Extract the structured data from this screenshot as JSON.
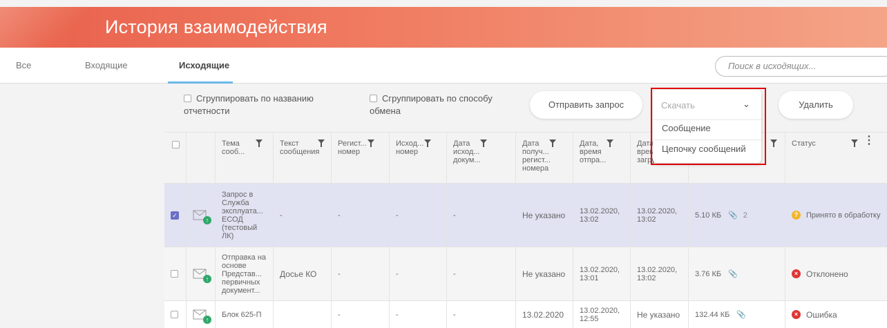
{
  "page_title": "История взаимодействия",
  "tabs": [
    "Все",
    "Входящие",
    "Исходящие"
  ],
  "search": {
    "placeholder": "Поиск в исходящих..."
  },
  "options": {
    "group_by_report": "Сгруппировать по названию отчетности",
    "group_by_exchange": "Сгруппировать по способу обмена"
  },
  "actions": {
    "send_request": "Отправить запрос",
    "download": "Скачать",
    "delete": "Удалить"
  },
  "download_menu": [
    "Сообщение",
    "Цепочку сообщений"
  ],
  "columns": [
    "Тема сооб...",
    "Текст сообщения",
    "Регист... номер",
    "Исход... номер",
    "Дата исход... докум...",
    "Дата получ... регист... номера",
    "Дата, время отпра...",
    "Дата, время загруз...",
    "",
    "Статус"
  ],
  "rows": [
    {
      "selected": true,
      "subject": "Запрос в Служба эксплуата... ЕСОД (тестовый ЛК)",
      "text": "-",
      "reg_no": "-",
      "out_no": "-",
      "out_date": "-",
      "reg_date": "Не указано",
      "sent": "13.02.2020, 13:02",
      "uploaded": "13.02.2020, 13:02",
      "size": "5.10 КБ",
      "attachments": "2",
      "status": "Принято в обработку",
      "status_color": "#f2b52b"
    },
    {
      "selected": false,
      "subject": "Отправка на основе Представ... первичных документ...",
      "text": "Досье КО",
      "reg_no": "-",
      "out_no": "-",
      "out_date": "-",
      "reg_date": "Не указано",
      "sent": "13.02.2020, 13:01",
      "uploaded": "13.02.2020, 13:02",
      "size": "3.76 КБ",
      "attachments": "",
      "status": "Отклонено",
      "status_color": "#e03535"
    },
    {
      "selected": false,
      "subject": "Блок 625-П",
      "text": "",
      "reg_no": "-",
      "out_no": "-",
      "out_date": "-",
      "reg_date": "13.02.2020",
      "sent": "13.02.2020, 12:55",
      "uploaded": "Не указано",
      "size": "132.44 КБ",
      "attachments": "",
      "status": "Ошибка",
      "status_color": "#e03535"
    }
  ]
}
